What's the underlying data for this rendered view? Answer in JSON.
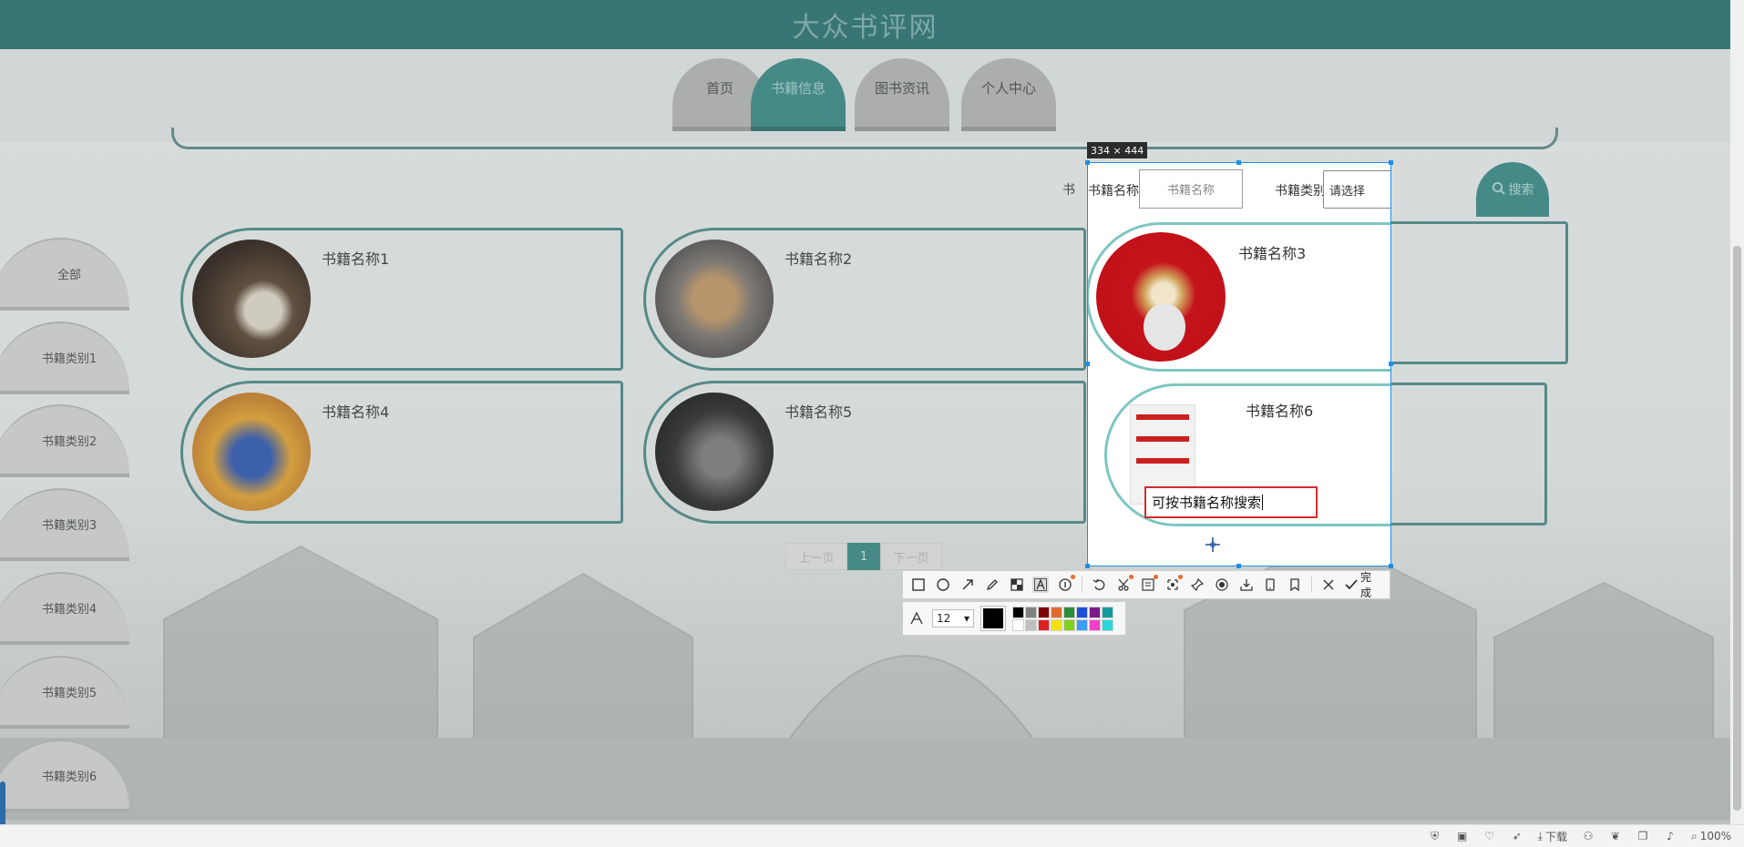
{
  "site_title": "大众书评网",
  "nav": {
    "tabs": [
      {
        "label": "首页"
      },
      {
        "label": "书籍信息"
      },
      {
        "label": "图书资讯"
      },
      {
        "label": "个人中心"
      }
    ]
  },
  "sidebar": {
    "items": [
      {
        "label": "全部"
      },
      {
        "label": "书籍类别1"
      },
      {
        "label": "书籍类别2"
      },
      {
        "label": "书籍类别3"
      },
      {
        "label": "书籍类别4"
      },
      {
        "label": "书籍类别5"
      },
      {
        "label": "书籍类别6"
      }
    ]
  },
  "search": {
    "name_label": "书籍名称",
    "name_placeholder": "书籍名称",
    "category_label": "书籍类别",
    "category_selected": "请选择",
    "button_label": "搜索"
  },
  "books": [
    {
      "title": "书籍名称1"
    },
    {
      "title": "书籍名称2"
    },
    {
      "title": "书籍名称3"
    },
    {
      "title": "书籍名称4"
    },
    {
      "title": "书籍名称5"
    },
    {
      "title": "书籍名称6"
    }
  ],
  "pagination": {
    "prev": "上一页",
    "current": "1",
    "next": "下一页"
  },
  "screenshot_tool": {
    "size_label": "334 × 444",
    "annotation_text": "可按书籍名称搜索",
    "done_label": "完成",
    "font_size": "12",
    "current_color": "#000000",
    "palette": [
      "#000000",
      "#808080",
      "#800000",
      "#e06b2f",
      "#2e8b3d",
      "#1e4fd8",
      "#7b1a8a",
      "#139c9c",
      "#ffffff",
      "#c0c0c0",
      "#e02020",
      "#f5e10a",
      "#7fd11b",
      "#3c9ef0",
      "#f040c8",
      "#2ad8d8"
    ]
  },
  "statusbar": {
    "download_label": "下载",
    "zoom_label": "100%"
  }
}
